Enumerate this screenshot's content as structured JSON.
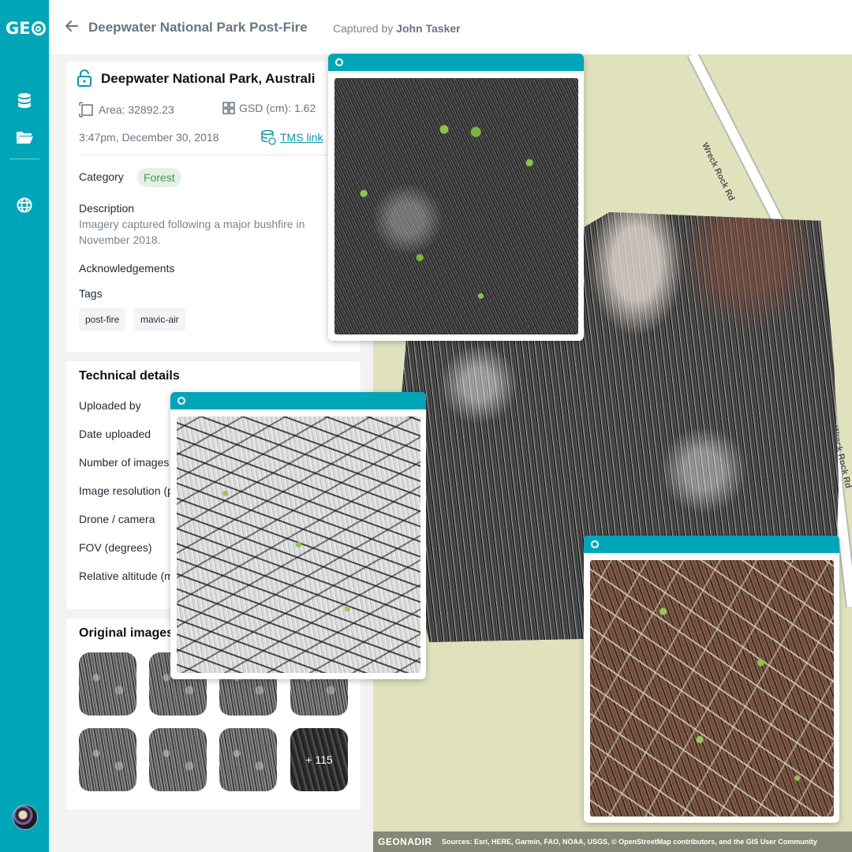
{
  "app": {
    "logo_text": "GE"
  },
  "header": {
    "title": "Deepwater National Park Post-Fire",
    "captured_prefix": "Captured by",
    "captured_by": "John Tasker"
  },
  "dataset": {
    "title": "Deepwater National Park, Australi",
    "area": "Area: 32892.23",
    "gsd": "GSD (cm): 1.62",
    "datetime": "3:47pm, December 30, 2018",
    "tms_link": "TMS link",
    "category_label": "Category",
    "category_value": "Forest",
    "description_label": "Description",
    "description_text": "Imagery captured following a major bushfire in November 2018.",
    "acknowledgements_label": "Acknowledgements",
    "tags_label": "Tags",
    "tags": [
      "post-fire",
      "mavic-air"
    ]
  },
  "technical": {
    "heading": "Technical details",
    "rows": [
      "Uploaded by",
      "Date uploaded",
      "Number of images",
      "Image resolution (p",
      "Drone / camera",
      "FOV (degrees)",
      "Relative altitude (m"
    ]
  },
  "original_images": {
    "heading": "Original images",
    "more_label": "+ 115"
  },
  "map": {
    "road_label": "Wreck Rock Rd",
    "attribution_logo": "GEONADIR",
    "attribution_text": "Sources: Esri, HERE, Garmin, FAO, NOAA, USGS, © OpenStreetMap contributors, and the GIS User Community"
  },
  "colors": {
    "accent": "#00a6b8",
    "category_pill_bg": "#e2f2e2",
    "category_pill_text": "#4a9550",
    "map_land": "#dfe2bd"
  }
}
